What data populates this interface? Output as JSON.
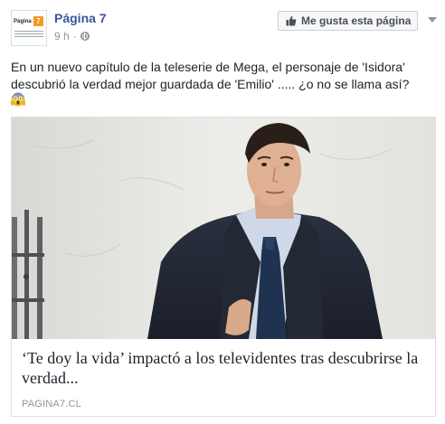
{
  "page": {
    "name": "Página 7",
    "avatar_text": "Página",
    "avatar_number": "7"
  },
  "post": {
    "time": "9 h",
    "separator": "·",
    "audience_icon": "globe-icon",
    "text": "En un nuevo capítulo de la teleserie de Mega, el personaje de 'Isidora' descubrió la verdad mejor guardada de 'Emilio' ..... ¿o no se llama así?",
    "emoji": "face-screaming-in-fear-emoji"
  },
  "like_button": {
    "label": "Me gusta esta página",
    "icon": "thumbs-up-icon"
  },
  "menu": {
    "icon": "chevron-down-icon"
  },
  "link_preview": {
    "title": "‘Te doy la vida’ impactó a los televidentes tras descubrirse la verdad...",
    "domain": "PAGINA7.CL",
    "image": "photo-man-in-suit"
  },
  "colors": {
    "page_name": "#365899",
    "meta": "#90949c",
    "text": "#1d2129",
    "border": "#dddfe2",
    "logo_orange": "#f39a1e"
  }
}
